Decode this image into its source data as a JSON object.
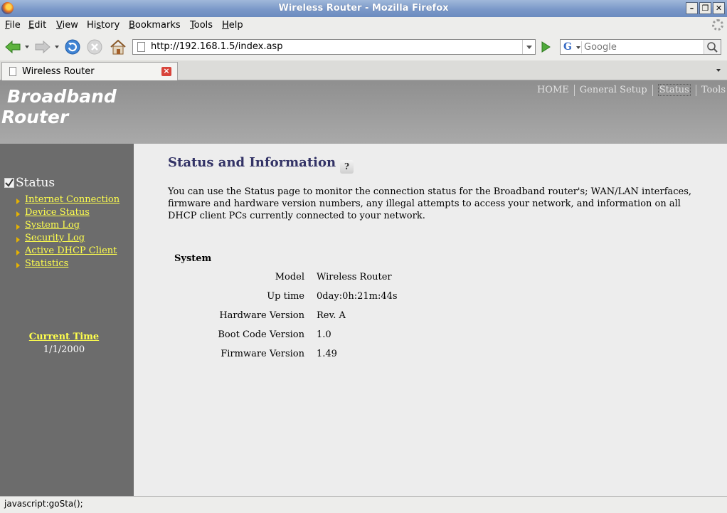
{
  "window": {
    "title": "Wireless Router - Mozilla Firefox"
  },
  "menu": [
    "File",
    "Edit",
    "View",
    "History",
    "Bookmarks",
    "Tools",
    "Help"
  ],
  "menu_mnemonics": [
    "F",
    "E",
    "V",
    "s",
    "B",
    "T",
    "H"
  ],
  "navbar": {
    "url": "http://192.168.1.5/index.asp",
    "search_placeholder": "Google",
    "search_engine_icon": "google-icon"
  },
  "tab": {
    "label": "Wireless Router"
  },
  "header": {
    "brand_line1": "Broadband",
    "brand_line2": "Router",
    "nav": [
      "HOME",
      "General Setup",
      "Status",
      "Tools"
    ],
    "active_nav": "Status"
  },
  "sidebar": {
    "title": "Status",
    "links": [
      "Internet Connection",
      "Device Status",
      "System Log",
      "Security Log",
      "Active DHCP Client",
      "Statistics"
    ],
    "time_title": "Current Time",
    "time_value": "1/1/2000"
  },
  "main": {
    "title": "Status and Information",
    "intro": "You can use the Status page to monitor the connection status for the Broadband router's; WAN/LAN interfaces, firmware and hardware version numbers, any illegal attempts to access your network, and information on all DHCP client PCs currently connected to your network.",
    "section": "System",
    "rows": [
      {
        "key": "Model",
        "value": "Wireless Router"
      },
      {
        "key": "Up time",
        "value": "0day:0h:21m:44s"
      },
      {
        "key": "Hardware Version",
        "value": "Rev. A"
      },
      {
        "key": "Boot Code Version",
        "value": "1.0"
      },
      {
        "key": "Firmware Version",
        "value": "1.49"
      }
    ]
  },
  "statusbar": {
    "text": "javascript:goSta();"
  },
  "colors": {
    "link": "#ffff4d",
    "sidebar": "#6c6c6c",
    "title": "#333366",
    "header": "#a0a0a0"
  }
}
